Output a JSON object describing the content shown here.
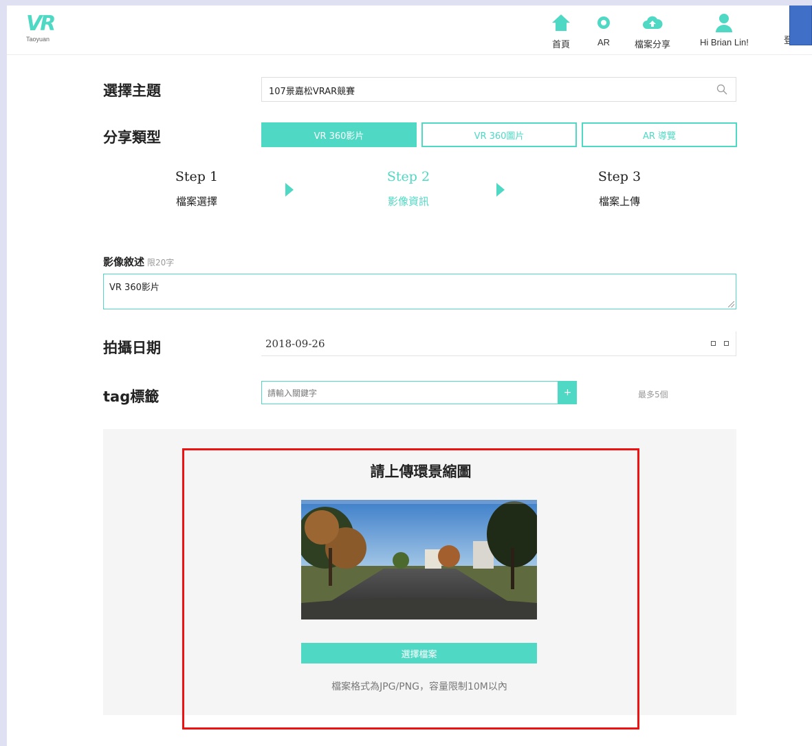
{
  "header": {
    "logo_text": "VR",
    "logo_sub": "Taoyuan",
    "nav": [
      {
        "label": "首頁",
        "icon": "home-icon"
      },
      {
        "label": "AR",
        "icon": "ar-circle-icon"
      },
      {
        "label": "檔案分享",
        "icon": "cloud-upload-icon"
      },
      {
        "label": "Hi Brian Lin!",
        "icon": "user-icon"
      },
      {
        "label": "登出",
        "icon": "logout-tab"
      }
    ]
  },
  "form": {
    "topic_label": "選擇主題",
    "topic_value": "107景嘉松VRAR競賽",
    "share_type_label": "分享類型",
    "share_types": [
      "VR 360影片",
      "VR 360圖片",
      "AR 導覽"
    ],
    "share_type_selected": "VR 360影片",
    "steps": [
      {
        "title": "Step 1",
        "sub": "檔案選擇"
      },
      {
        "title": "Step 2",
        "sub": "影像資訊"
      },
      {
        "title": "Step 3",
        "sub": "檔案上傳"
      }
    ],
    "current_step": 2,
    "desc_label": "影像敘述",
    "desc_hint": "限20字",
    "desc_value": "VR 360影片",
    "date_label": "拍攝日期",
    "date_value": "2018-09-26",
    "tag_label": "tag標籤",
    "tag_placeholder": "請輸入關鍵字",
    "tag_add": "+",
    "tag_limit": "最多5個"
  },
  "upload": {
    "title": "請上傳環景縮圖",
    "button_label": "選擇檔案",
    "note": "檔案格式為JPG/PNG，容量限制10M以內"
  },
  "colors": {
    "accent": "#4fd8c4",
    "highlight": "#ee1111",
    "panel": "#f5f5f5"
  }
}
